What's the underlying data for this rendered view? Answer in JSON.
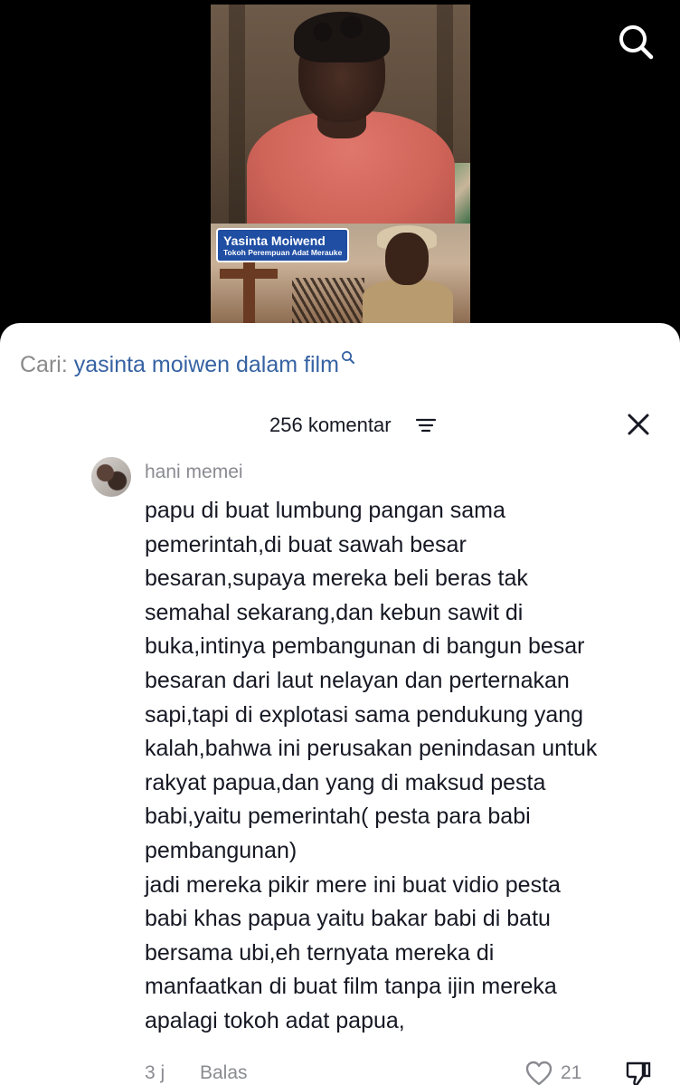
{
  "video": {
    "caption_name": "Yasinta Moiwend",
    "caption_subtitle": "Tokoh Perempuan Adat Merauke",
    "search_icon": "search-icon"
  },
  "search_suggestion": {
    "label": "Cari:",
    "query": "yasinta moiwen dalam film",
    "icon": "search-icon"
  },
  "comments_header": {
    "count_label": "256 komentar",
    "sort_icon": "filter-lines-icon",
    "close_icon": "close-icon"
  },
  "comment": {
    "username": "hani memei",
    "lines": [
      "papu di buat lumbung pangan sama",
      "pemerintah,di buat sawah besar",
      "besaran,supaya mereka beli beras tak",
      "semahal sekarang,dan kebun sawit di",
      "buka,intinya pembangunan di bangun besar",
      "besaran dari laut nelayan dan perternakan",
      "sapi,tapi di explotasi sama pendukung yang",
      "kalah,bahwa ini perusakan penindasan untuk",
      "rakyat papua,dan yang di maksud pesta",
      "babi,yaitu pemerintah( pesta para babi",
      "pembangunan)",
      "jadi mereka pikir mere ini buat vidio pesta",
      "babi khas papua yaitu bakar babi di batu",
      "bersama ubi,eh ternyata mereka di",
      "manfaatkan di buat film tanpa ijin mereka",
      "apalagi tokoh adat papua,"
    ],
    "time_ago": "3 j",
    "reply_label": "Balas",
    "like_count": "21"
  }
}
